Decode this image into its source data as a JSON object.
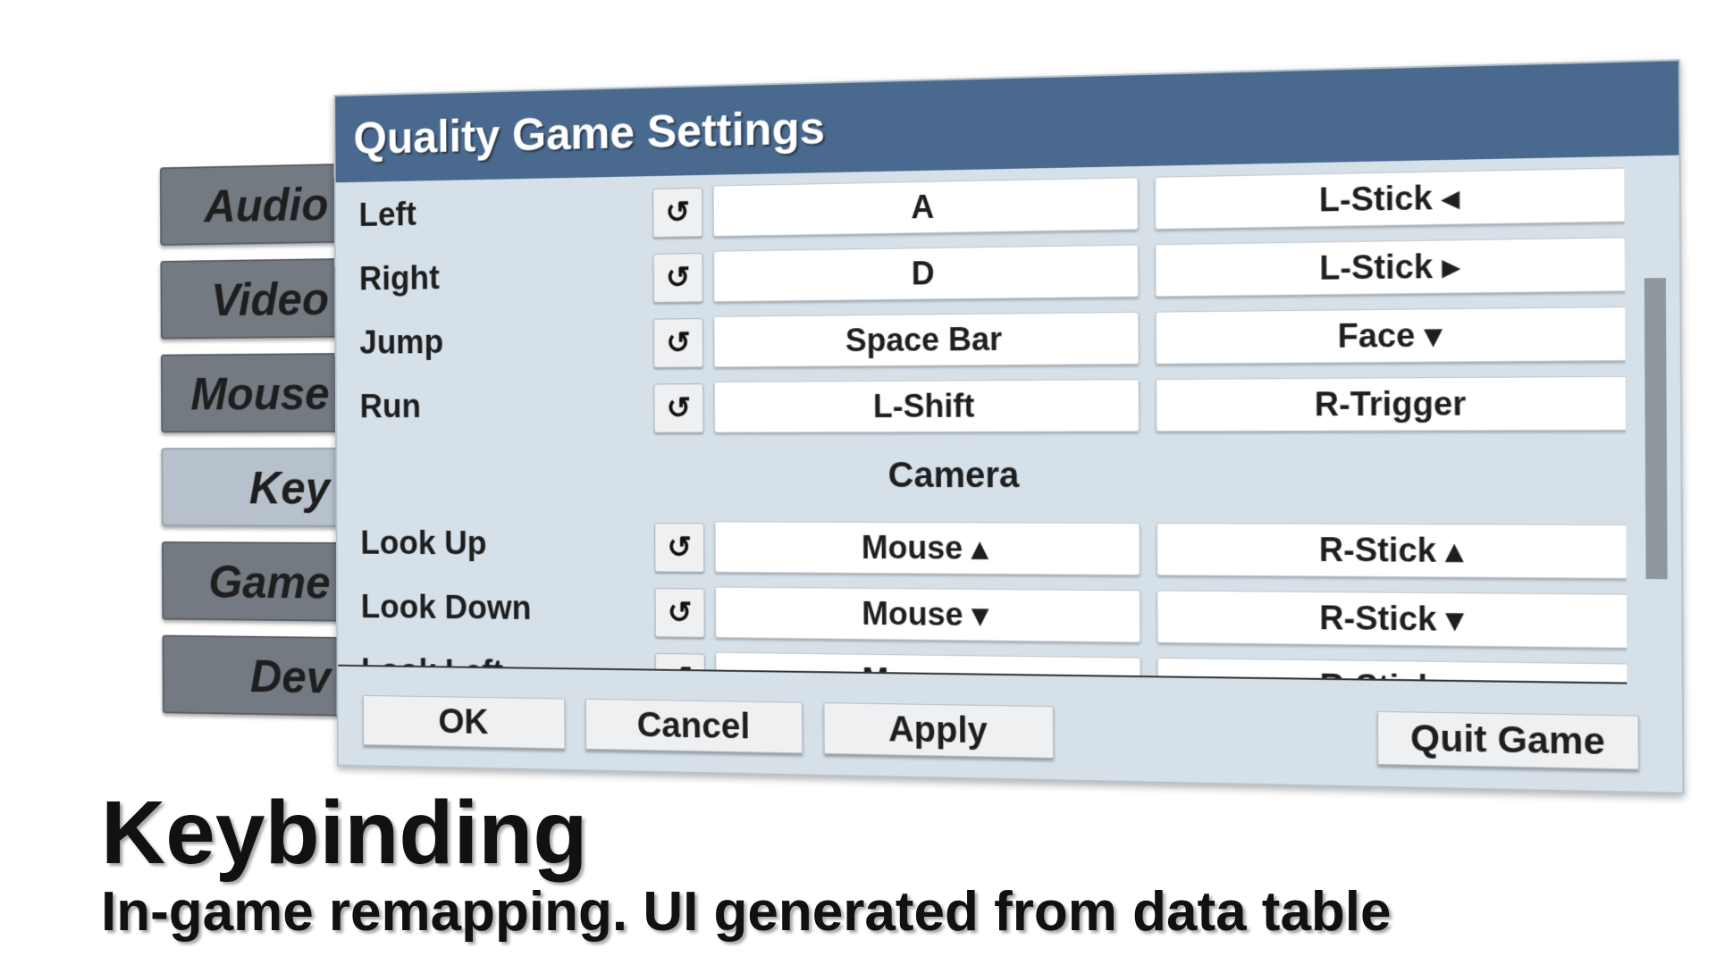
{
  "window": {
    "title": "Quality Game Settings"
  },
  "tabs": [
    {
      "label": "Audio",
      "active": false
    },
    {
      "label": "Video",
      "active": false
    },
    {
      "label": "Mouse",
      "active": false
    },
    {
      "label": "Key",
      "active": true
    },
    {
      "label": "Game",
      "active": false
    },
    {
      "label": "Dev",
      "active": false
    }
  ],
  "bindings": [
    {
      "action": "Left",
      "primary": "A",
      "secondary": "L-Stick ◂"
    },
    {
      "action": "Right",
      "primary": "D",
      "secondary": "L-Stick ▸"
    },
    {
      "action": "Jump",
      "primary": "Space Bar",
      "secondary": "Face ▾"
    },
    {
      "action": "Run",
      "primary": "L-Shift",
      "secondary": "R-Trigger"
    }
  ],
  "camera_section": {
    "title": "Camera",
    "bindings": [
      {
        "action": "Look Up",
        "primary": "Mouse ▴",
        "secondary": "R-Stick ▴"
      },
      {
        "action": "Look Down",
        "primary": "Mouse ▾",
        "secondary": "R-Stick ▾"
      },
      {
        "action": "Look Left",
        "primary": "Mouse ◂",
        "secondary": "R-Stick ◂"
      }
    ]
  },
  "reset_icon": "↺",
  "footer": {
    "ok": "OK",
    "cancel": "Cancel",
    "apply": "Apply",
    "quit": "Quit Game"
  },
  "caption": {
    "title": "Keybinding",
    "subtitle": "In-game remapping. UI generated from data table"
  },
  "colors": {
    "titlebar": "#49698f",
    "panel": "#d6e0e8",
    "tab": "#737a82",
    "tab_active": "#b6c1cc"
  }
}
